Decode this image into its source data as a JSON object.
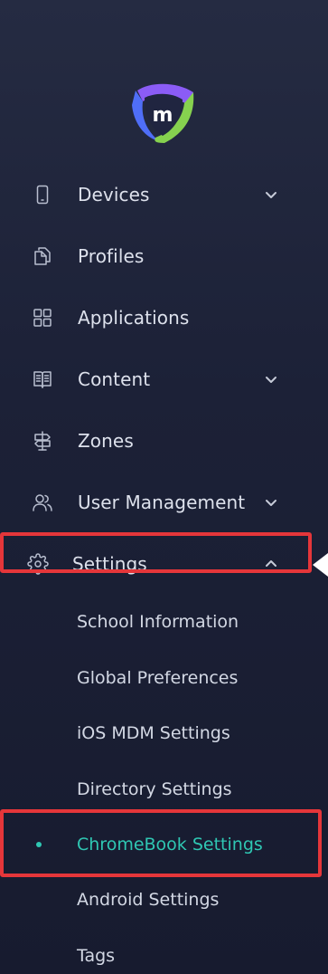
{
  "brand": {
    "logo_letter": "m",
    "colors": {
      "purple": "#8b5cf6",
      "blue": "#4f6ef7",
      "green": "#86d14f"
    }
  },
  "nav": [
    {
      "label": "Devices",
      "icon": "device-phone-icon",
      "chevron": "down"
    },
    {
      "label": "Profiles",
      "icon": "profiles-icon",
      "chevron": null
    },
    {
      "label": "Applications",
      "icon": "apps-grid-icon",
      "chevron": null
    },
    {
      "label": "Content",
      "icon": "book-icon",
      "chevron": "down"
    },
    {
      "label": "Zones",
      "icon": "signpost-icon",
      "chevron": null
    },
    {
      "label": "User Management",
      "icon": "users-icon",
      "chevron": "down"
    },
    {
      "label": "Settings",
      "icon": "gear-icon",
      "chevron": "up"
    }
  ],
  "settings_submenu": [
    {
      "label": "School Information",
      "active": false
    },
    {
      "label": "Global Preferences",
      "active": false
    },
    {
      "label": "iOS MDM Settings",
      "active": false
    },
    {
      "label": "Directory Settings",
      "active": false
    },
    {
      "label": "ChromeBook Settings",
      "active": true
    },
    {
      "label": "Android Settings",
      "active": false
    },
    {
      "label": "Tags",
      "active": false
    }
  ],
  "theme": {
    "accent": "#2fc7b3",
    "highlight": "#e5363a",
    "background_top": "#252b42",
    "background_bottom": "#171b2f"
  }
}
